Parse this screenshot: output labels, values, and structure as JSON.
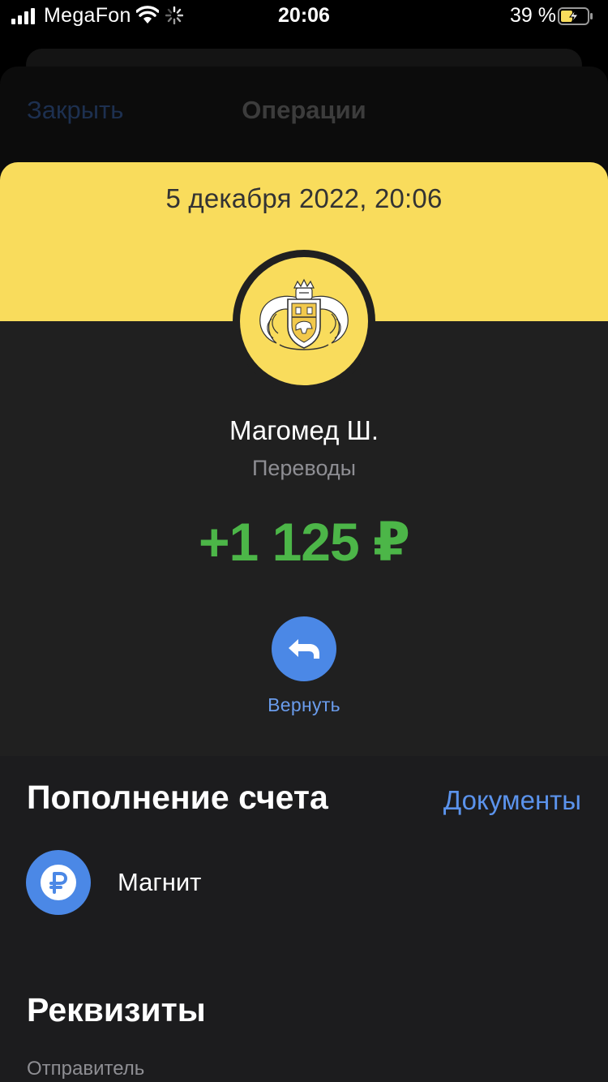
{
  "status_bar": {
    "carrier": "MegaFon",
    "time": "20:06",
    "battery_percent": "39 %",
    "icons": [
      "signal-icon",
      "wifi-icon",
      "activity-spinner-icon",
      "battery-charging-icon"
    ]
  },
  "background_sheet": {
    "close_label": "Закрыть",
    "title": "Операции"
  },
  "operation": {
    "date": "5 декабря 2022, 20:06",
    "merchant": "Магомед Ш.",
    "category": "Переводы",
    "amount": "+1 125 ₽",
    "return_label": "Вернуть"
  },
  "section": {
    "title": "Пополнение счета",
    "documents_link": "Документы"
  },
  "payee": {
    "name": "Магнит",
    "icon": "ruble-icon"
  },
  "details": {
    "title": "Реквизиты",
    "sender_label": "Отправитель"
  },
  "colors": {
    "brand_yellow": "#f9dc5c",
    "amount_green": "#4cb648",
    "accent_blue": "#4b88e6",
    "link_blue": "#5b93ec"
  }
}
